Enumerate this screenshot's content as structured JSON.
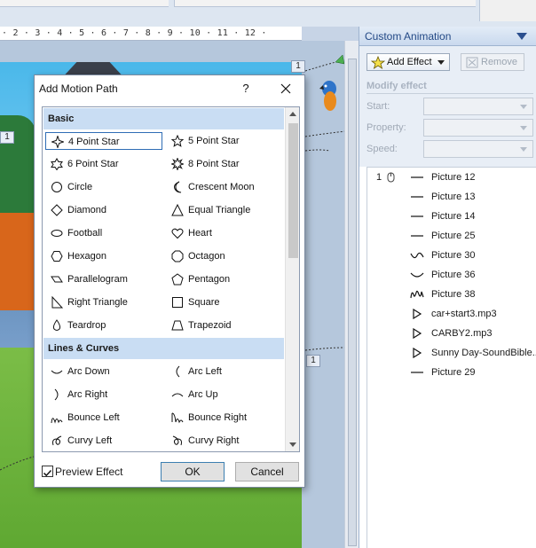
{
  "window": {
    "ruler_text": "· 2 · 3 · 4 · 5 · 6 · 7 · 8 · 9 · 10 · 11 · 12 ·",
    "slide_tags": [
      "1",
      "1",
      "1"
    ]
  },
  "pane": {
    "title": "Custom Animation",
    "add_effect": "Add Effect",
    "remove": "Remove",
    "modify_title": "Modify effect",
    "start_label": "Start:",
    "property_label": "Property:",
    "speed_label": "Speed:",
    "first_number": "1",
    "effects": [
      {
        "label": "Picture 12",
        "icon": "line-path-icon"
      },
      {
        "label": "Picture 13",
        "icon": "line-path-icon"
      },
      {
        "label": "Picture 14",
        "icon": "line-path-icon"
      },
      {
        "label": "Picture 25",
        "icon": "line-path-icon"
      },
      {
        "label": "Picture 30",
        "icon": "wave-path-icon"
      },
      {
        "label": "Picture 36",
        "icon": "arc-path-icon"
      },
      {
        "label": "Picture 38",
        "icon": "loop-path-icon"
      },
      {
        "label": "car+start3.mp3",
        "icon": "play-icon"
      },
      {
        "label": "CARBY2.mp3",
        "icon": "play-icon"
      },
      {
        "label": "Sunny Day-SoundBible...",
        "icon": "play-icon"
      },
      {
        "label": "Picture 29",
        "icon": "line-path-icon"
      }
    ],
    "accent_color": "#244a86"
  },
  "dialog": {
    "title": "Add Motion Path",
    "help": "?",
    "basic_header": "Basic",
    "lines_header": "Lines & Curves",
    "basic_left": [
      "4 Point Star",
      "6 Point Star",
      "Circle",
      "Diamond",
      "Football",
      "Hexagon",
      "Parallelogram",
      "Right Triangle",
      "Teardrop"
    ],
    "basic_right": [
      "5 Point Star",
      "8 Point Star",
      "Crescent Moon",
      "Equal Triangle",
      "Heart",
      "Octagon",
      "Pentagon",
      "Square",
      "Trapezoid"
    ],
    "lines_left": [
      "Arc Down",
      "Arc Right",
      "Bounce Left",
      "Curvy Left"
    ],
    "lines_right": [
      "Arc Left",
      "Arc Up",
      "Bounce Right",
      "Curvy Right"
    ],
    "selected_item": "4 Point Star",
    "preview_label": "Preview Effect",
    "preview_checked": true,
    "ok": "OK",
    "cancel": "Cancel",
    "header_color": "#c9ddf3"
  }
}
